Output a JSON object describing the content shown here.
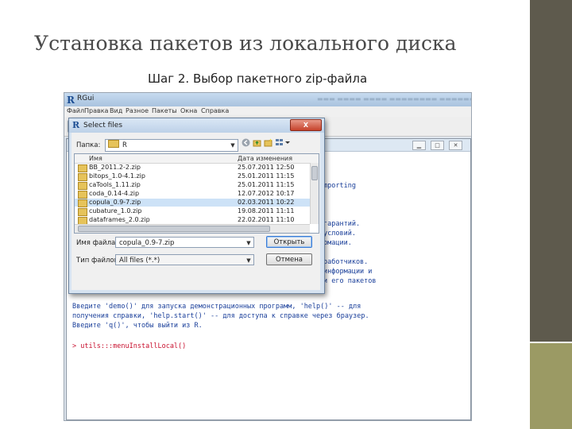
{
  "slide": {
    "title": "Установка пакетов из локального диска",
    "subtitle": "Шаг 2. Выбор пакетного zip-файла"
  },
  "rgui": {
    "window_title": "RGui",
    "menu": [
      "Файл",
      "Правка",
      "Вид",
      "Разное",
      "Пакеты",
      "Окна",
      "Справка"
    ],
    "console_lines": [
      {
        "text": "mporting",
        "color": "blue"
      },
      {
        "text": "гарантий.",
        "color": "blue"
      },
      {
        "text": "условий.",
        "color": "blue"
      },
      {
        "text": "рмации.",
        "color": "blue"
      },
      {
        "text": "работчиков.",
        "color": "blue"
      },
      {
        "text": "информации и",
        "color": "blue"
      },
      {
        "text": "и его пакетов",
        "color": "blue"
      },
      {
        "text": "Введите 'demo()' для запуска демонстрационных программ, 'help()' -- для",
        "color": "blue"
      },
      {
        "text": "получения справки, 'help.start()' -- для доступа к справке через браузер.",
        "color": "blue"
      },
      {
        "text": "Введите 'q()', чтобы выйти из R.",
        "color": "blue"
      },
      {
        "text": "> utils:::menuInstallLocal()",
        "color": "red"
      }
    ]
  },
  "dialog": {
    "title": "Select files",
    "close_label": "X",
    "folder_label": "Папка:",
    "folder_value": "R",
    "columns": {
      "name": "Имя",
      "date": "Дата изменения"
    },
    "files": [
      {
        "name": "BB_2011.2-2.zip",
        "date": "25.07.2011 12:50"
      },
      {
        "name": "bitops_1.0-4.1.zip",
        "date": "25.01.2011 11:15"
      },
      {
        "name": "caTools_1.11.zip",
        "date": "25.01.2011 11:15"
      },
      {
        "name": "coda_0.14-4.zip",
        "date": "12.07.2012 10:17"
      },
      {
        "name": "copula_0.9-7.zip",
        "date": "02.03.2011 10:22"
      },
      {
        "name": "cubature_1.0.zip",
        "date": "19.08.2011 11:11"
      },
      {
        "name": "dataframes_2.0.zip",
        "date": "22.02.2011 11:10"
      }
    ],
    "selected_index": 4,
    "filename_label": "Имя файла:",
    "filename_value": "copula_0.9-7.zip",
    "filetype_label": "Тип файлов:",
    "filetype_value": "All files (*.*)",
    "open_label": "Открыть",
    "cancel_label": "Отмена"
  },
  "colors": {
    "console_blue": "#1a3f9a",
    "console_red": "#c8102e",
    "sidebar_dark": "#5e5a4d",
    "sidebar_olive": "#9b9a64"
  }
}
